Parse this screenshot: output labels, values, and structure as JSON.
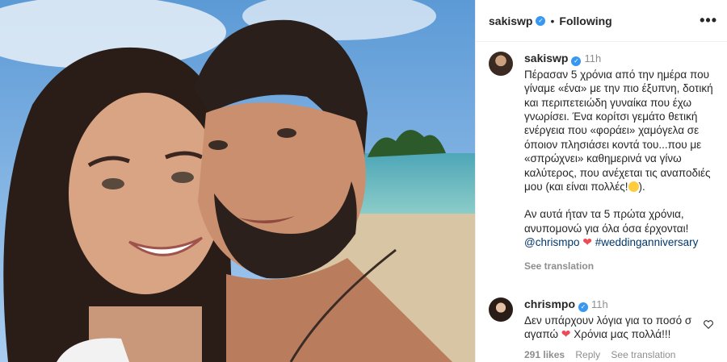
{
  "post": {
    "header": {
      "username": "sakiswp",
      "follow_status": "Following",
      "more_label": "•••"
    },
    "caption": {
      "username": "sakiswp",
      "time": "11h",
      "line1": "Πέρασαν 5 χρόνια από την ημέρα που γίναμε «ένα» με την πιο έξυπνη, δοτική και περιπετειώδη γυναίκα που έχω γνωρίσει. Ένα κορίτσι γεμάτο θετική ενέργεια που «φοράει» χαμόγελα σε όποιον πλησιάσει κοντά του...που με «σπρώχνει» καθημερινά να γίνω καλύτερος, που ανέχεται τις αναποδιές μου (και είναι πολλές!",
      "line1_end": ").",
      "line2": "Αν αυτά ήταν τα 5 πρώτα χρόνια, ανυπομονώ για όλα όσα έρχονται!",
      "mention": "@chrismpo",
      "hashtag": "#weddinganniversary",
      "see_translation": "See translation"
    },
    "reply": {
      "username": "chrismpo",
      "time": "11h",
      "text1": "Δεν υπάρχουν λόγια για το ποσό σ αγαπώ",
      "text2": "Χρόνια μας πολλά!!!",
      "likes": "291 likes",
      "reply_label": "Reply",
      "see_translation": "See translation"
    }
  },
  "icons": {
    "verified": "verified-badge-icon",
    "heart": "red-heart-emoji",
    "smile": "laughing-emoji",
    "like": "heart-outline-icon"
  },
  "colors": {
    "verified": "#3897f0",
    "heart": "#ed4956",
    "link": "#00376b",
    "muted": "#8e8e8e"
  }
}
